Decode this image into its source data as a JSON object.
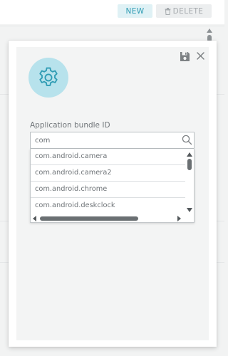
{
  "toolbar": {
    "new_label": "NEW",
    "delete_label": "DELETE",
    "delete_icon": "trash-icon"
  },
  "dialog": {
    "save_icon": "save-icon",
    "close_icon": "close-icon",
    "header_icon": "gear-icon",
    "field": {
      "label": "Application bundle ID",
      "value": "com",
      "search_icon": "search-icon"
    },
    "suggestions": [
      "com.android.camera",
      "com.android.camera2",
      "com.android.chrome",
      "com.android.deskclock"
    ]
  },
  "colors": {
    "accent": "#2f9cb4",
    "gear_circle": "#b7e2ec",
    "new_button_bg": "#dff1f5"
  }
}
